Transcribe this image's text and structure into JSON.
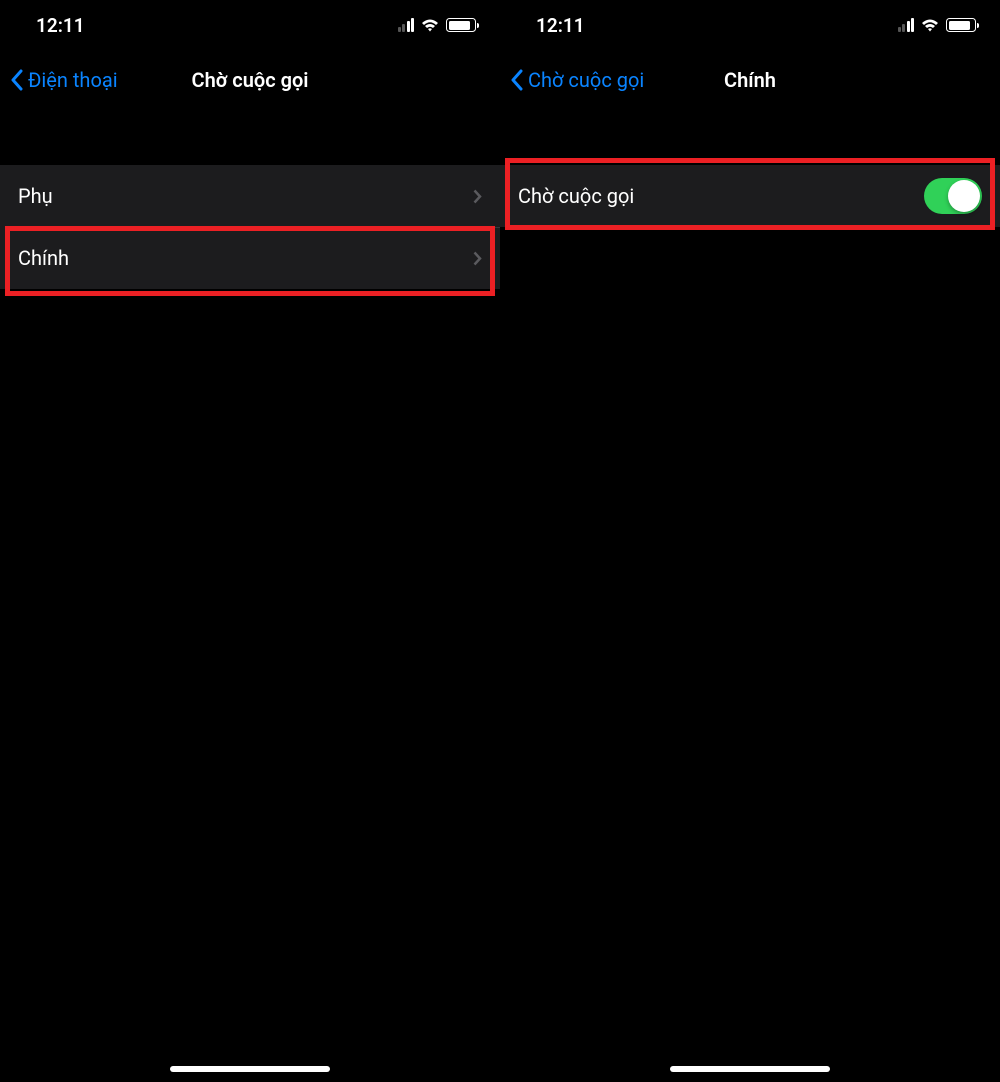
{
  "status": {
    "time": "12:11"
  },
  "left_screen": {
    "back_label": "Điện thoại",
    "title": "Chờ cuộc gọi",
    "items": [
      {
        "label": "Phụ"
      },
      {
        "label": "Chính"
      }
    ]
  },
  "right_screen": {
    "back_label": "Chờ cuộc gọi",
    "title": "Chính",
    "toggle": {
      "label": "Chờ cuộc gọi",
      "on": true
    }
  },
  "colors": {
    "ios_blue": "#0a84ff",
    "ios_green": "#30d158",
    "highlight": "#ec2024",
    "cell_bg": "#1c1c1e"
  }
}
